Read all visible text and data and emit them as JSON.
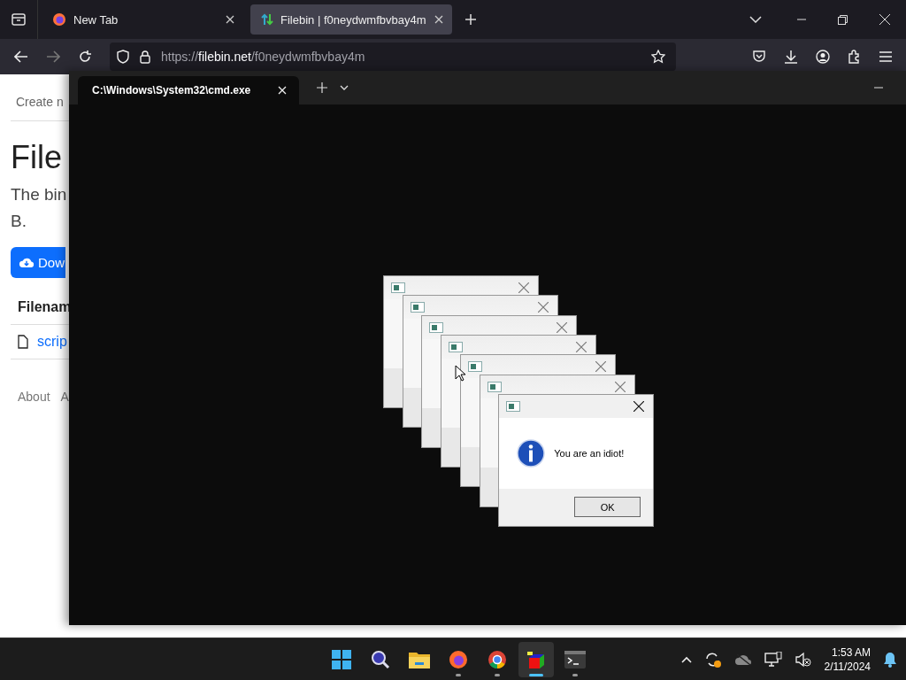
{
  "browser": {
    "tabs": [
      {
        "title": "New Tab",
        "selected": false,
        "kind": "firefox"
      },
      {
        "title": "Filebin | f0neydwmfbvbay4m",
        "selected": true,
        "kind": "filebin"
      }
    ],
    "url": {
      "scheme": "https://",
      "host": "filebin.net",
      "path": "/f0neydwmfbvbay4m"
    }
  },
  "page": {
    "nav_link": "Create n",
    "heading": "File",
    "description": [
      "The bin",
      "B."
    ],
    "download_button": "Dow",
    "table_header": "Filenam",
    "file_link": "scrip",
    "footer_links": [
      "About",
      "A"
    ]
  },
  "terminal": {
    "tab_title": "C:\\Windows\\System32\\cmd.exe"
  },
  "dialogs": [
    {
      "kind": "behind"
    },
    {
      "kind": "behind"
    },
    {
      "kind": "behind"
    },
    {
      "kind": "behind"
    },
    {
      "kind": "behind"
    },
    {
      "kind": "behind"
    },
    {
      "kind": "front",
      "message": "You are an idiot!",
      "button": "OK"
    }
  ],
  "taskbar": {
    "apps": [
      {
        "kind": "start",
        "running": false,
        "selected": false
      },
      {
        "kind": "search",
        "running": false,
        "selected": false
      },
      {
        "kind": "folder",
        "running": false,
        "selected": false
      },
      {
        "kind": "firefox",
        "running": true,
        "selected": false
      },
      {
        "kind": "chrome",
        "running": true,
        "selected": false
      },
      {
        "kind": "cube",
        "running": true,
        "selected": true
      },
      {
        "kind": "terminal",
        "running": true,
        "selected": false
      }
    ],
    "time": "1:53 AM",
    "date": "2/11/2024"
  }
}
